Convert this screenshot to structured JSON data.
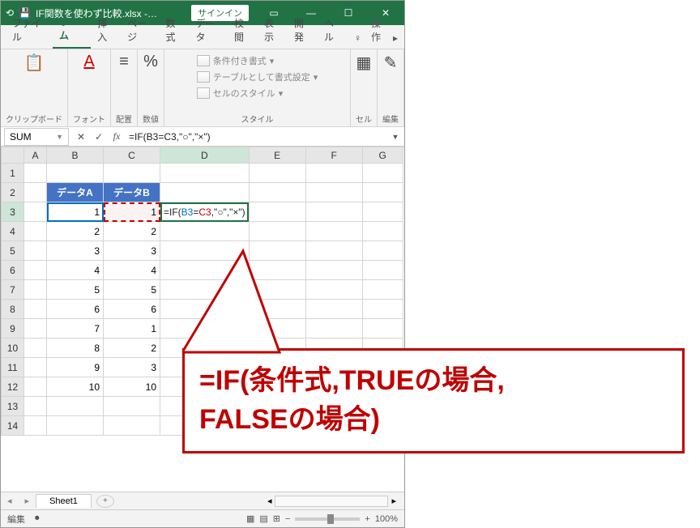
{
  "titlebar": {
    "filename": "IF関数を使わず比較.xlsx -…",
    "signin": "サインイン"
  },
  "tabs": {
    "file": "ファイル",
    "home": "ホーム",
    "insert": "挿入",
    "page": "ページ",
    "formula": "数式",
    "data": "データ",
    "review": "校閲",
    "view": "表示",
    "dev": "開発",
    "help": "ヘル",
    "share": "操作"
  },
  "ribbon": {
    "clipboard": "クリップボード",
    "font": "フォント",
    "align": "配置",
    "number": "数値",
    "styles": "スタイル",
    "cond": "条件付き書式",
    "tblfmt": "テーブルとして書式設定",
    "cellstyle": "セルのスタイル",
    "cells": "セル",
    "edit": "編集"
  },
  "fbar": {
    "name": "SUM",
    "formula": "=IF(B3=C3,\"○\",\"×\")"
  },
  "cols": {
    "A": "A",
    "B": "B",
    "C": "C",
    "D": "D",
    "E": "E",
    "F": "F",
    "G": "G"
  },
  "headers": {
    "dataA": "データA",
    "dataB": "データB"
  },
  "rows": [
    {
      "n": "1"
    },
    {
      "n": "2"
    },
    {
      "n": "3",
      "b": "1",
      "c": "1",
      "d_fn1": "=IF(",
      "d_b": "B3",
      "d_eq": "=",
      "d_c": "C3",
      "d_fn2": ",\"○\",\"×\")"
    },
    {
      "n": "4",
      "b": "2",
      "c": "2"
    },
    {
      "n": "5",
      "b": "3",
      "c": "3"
    },
    {
      "n": "6",
      "b": "4",
      "c": "4"
    },
    {
      "n": "7",
      "b": "5",
      "c": "5"
    },
    {
      "n": "8",
      "b": "6",
      "c": "6"
    },
    {
      "n": "9",
      "b": "7",
      "c": "1"
    },
    {
      "n": "10",
      "b": "8",
      "c": "2"
    },
    {
      "n": "11",
      "b": "9",
      "c": "3"
    },
    {
      "n": "12",
      "b": "10",
      "c": "10"
    },
    {
      "n": "13"
    },
    {
      "n": "14"
    }
  ],
  "sheet": {
    "tab1": "Sheet1"
  },
  "status": {
    "mode": "編集",
    "zoom": "100%"
  },
  "callout": {
    "line1": "=IF(条件式,TRUEの場合,",
    "line2": "FALSEの場合)"
  }
}
